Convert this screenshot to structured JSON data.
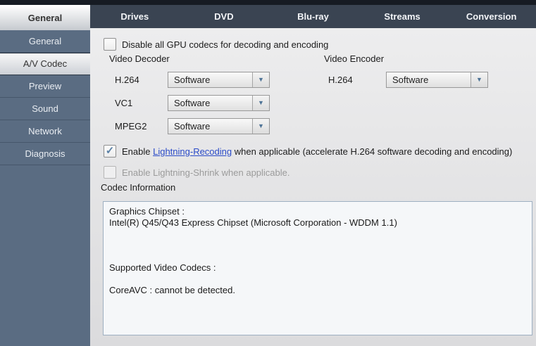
{
  "tabs": {
    "items": [
      {
        "label": "General",
        "selected": true
      },
      {
        "label": "Drives",
        "selected": false
      },
      {
        "label": "DVD",
        "selected": false
      },
      {
        "label": "Blu-ray",
        "selected": false
      },
      {
        "label": "Streams",
        "selected": false
      },
      {
        "label": "Conversion",
        "selected": false
      }
    ]
  },
  "sidebar": {
    "items": [
      {
        "label": "General",
        "selected": false
      },
      {
        "label": "A/V Codec",
        "selected": true
      },
      {
        "label": "Preview",
        "selected": false
      },
      {
        "label": "Sound",
        "selected": false
      },
      {
        "label": "Network",
        "selected": false
      },
      {
        "label": "Diagnosis",
        "selected": false
      }
    ]
  },
  "panel": {
    "gpu_checkbox": {
      "label": "Disable all GPU codecs for decoding and encoding",
      "checked": false
    },
    "video_decoder": {
      "title": "Video Decoder",
      "rows": [
        {
          "codec": "H.264",
          "value": "Software"
        },
        {
          "codec": "VC1",
          "value": "Software"
        },
        {
          "codec": "MPEG2",
          "value": "Software"
        }
      ]
    },
    "video_encoder": {
      "title": "Video Encoder",
      "rows": [
        {
          "codec": "H.264",
          "value": "Software"
        }
      ]
    },
    "lightning_recoding": {
      "checked": true,
      "text_before": "Enable ",
      "link_text": "Lightning-Recoding",
      "text_after": " when applicable (accelerate H.264 software decoding and encoding)"
    },
    "lightning_shrink": {
      "checked": false,
      "disabled": true,
      "label": "Enable Lightning-Shrink when applicable."
    },
    "codec_information": {
      "title": "Codec Information",
      "lines": [
        "Graphics Chipset :",
        "Intel(R) Q45/Q43 Express Chipset (Microsoft Corporation - WDDM 1.1)",
        "",
        "",
        "",
        "Supported Video Codecs :",
        "",
        "CoreAVC : cannot be detected."
      ]
    }
  },
  "icons": {
    "dropdown_arrow": "▼",
    "checkmark": "✓"
  },
  "colors": {
    "sidebar_bg": "#5a6c82",
    "tabbar_bg": "#3a4452",
    "top_strip": "#161b23",
    "content_bg": "#e4e4e6",
    "checkmark_accent": "#5b81a6",
    "link": "#2b4bc8",
    "info_box_border": "#9eafc1",
    "info_box_bg": "#f5f7f9"
  }
}
